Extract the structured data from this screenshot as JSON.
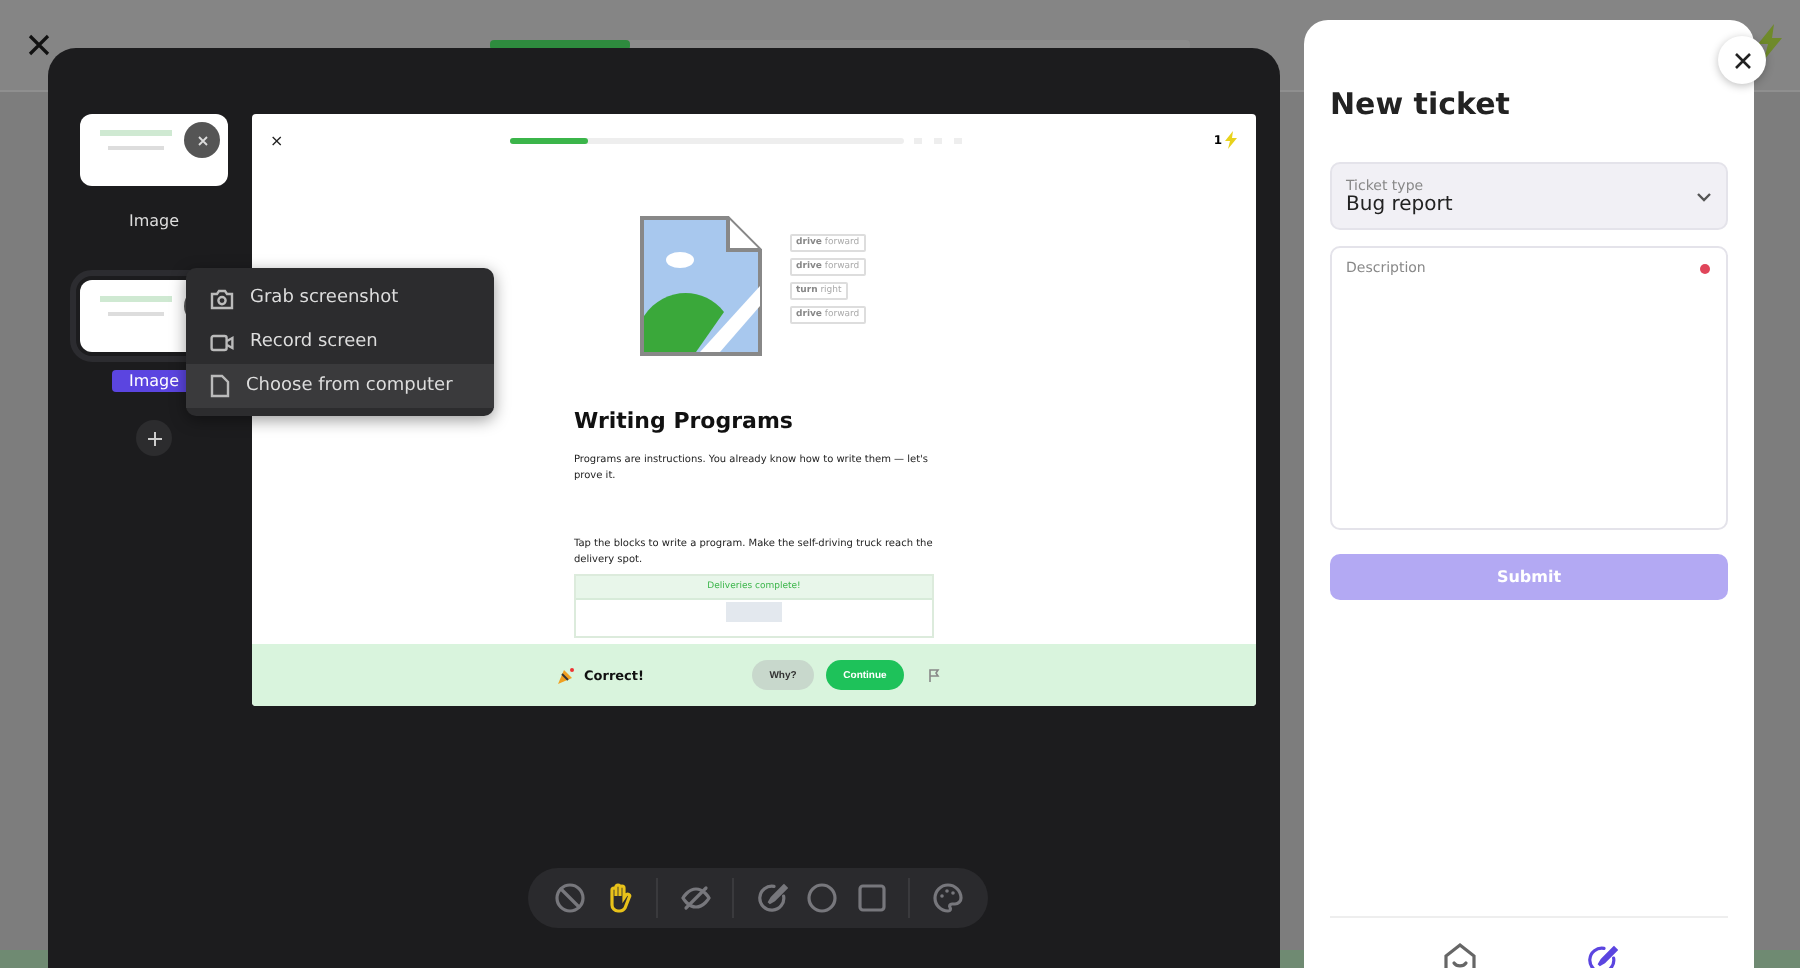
{
  "background": {
    "progress": {
      "level": 0.2
    }
  },
  "editor": {
    "thumbnails": [
      {
        "label": "Image",
        "selected": false
      },
      {
        "label": "Image",
        "selected": true
      }
    ],
    "source_menu": [
      {
        "kind": "camera",
        "label": "Grab screenshot",
        "selected": false
      },
      {
        "kind": "video",
        "label": "Record screen",
        "selected": false
      },
      {
        "kind": "file",
        "label": "Choose from computer",
        "selected": true
      }
    ],
    "screenshot": {
      "close": "×",
      "progress": {
        "level": 0.2
      },
      "streak": "1",
      "blocks": [
        "**drive** forward",
        "**drive** forward",
        "**turn** right",
        "**drive** forward"
      ],
      "title": "Writing Programs",
      "intro": "Programs are instructions. You already know how to write them — let's prove it.",
      "task": "Tap the blocks to write a program. Make the self-driving truck reach the delivery spot.",
      "banner": "Deliveries complete!",
      "result": "Correct!",
      "why_button": "Why?",
      "continue_button": "Continue"
    },
    "tools": [
      {
        "kind": "no-draw",
        "selected": false
      },
      {
        "kind": "hand",
        "selected": true
      },
      {
        "kind": "hide",
        "selected": false
      },
      {
        "kind": "pen",
        "selected": false
      },
      {
        "kind": "circle",
        "selected": false
      },
      {
        "kind": "square",
        "selected": false
      },
      {
        "kind": "palette",
        "selected": false
      }
    ]
  },
  "ticket": {
    "title": "New ticket",
    "ticket_type": {
      "label": "Ticket type",
      "value": "Bug report"
    },
    "description": {
      "placeholder": "Description",
      "required": true
    },
    "submit": {
      "label": "Submit",
      "disabled": true
    },
    "nav": [
      {
        "kind": "inbox",
        "selected": false
      },
      {
        "kind": "pen",
        "selected": true
      }
    ]
  }
}
